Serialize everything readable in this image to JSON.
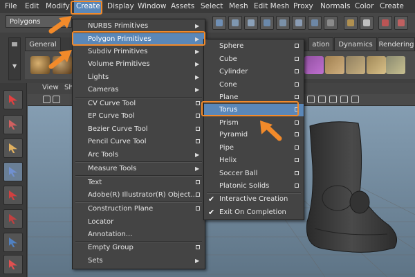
{
  "menubar": {
    "items": [
      "File",
      "Edit",
      "Modify",
      "Create",
      "Display",
      "Window",
      "Assets",
      "Select",
      "Mesh",
      "Edit Mesh",
      "Proxy",
      "Normals",
      "Color",
      "Create UVs"
    ]
  },
  "statusline": {
    "mode": "Polygons"
  },
  "shelf": {
    "tabs": [
      "General",
      "ation",
      "Dynamics",
      "Rendering"
    ]
  },
  "viewport": {
    "menu": [
      "View",
      "Sh"
    ]
  },
  "create_menu": {
    "items": [
      {
        "label": "NURBS Primitives",
        "arrow": true
      },
      {
        "label": "Polygon Primitives",
        "arrow": true
      },
      {
        "label": "Subdiv Primitives",
        "arrow": true
      },
      {
        "label": "Volume Primitives",
        "arrow": true
      },
      {
        "label": "Lights",
        "arrow": true
      },
      {
        "label": "Cameras",
        "arrow": true
      },
      {
        "label": "CV Curve Tool",
        "opt": true
      },
      {
        "label": "EP Curve Tool",
        "opt": true
      },
      {
        "label": "Bezier Curve Tool",
        "opt": true
      },
      {
        "label": "Pencil Curve Tool",
        "opt": true
      },
      {
        "label": "Arc Tools",
        "arrow": true
      },
      {
        "label": "Measure Tools",
        "arrow": true
      },
      {
        "label": "Text",
        "opt": true
      },
      {
        "label": "Adobe(R) Illustrator(R) Object...",
        "opt": true
      },
      {
        "label": "Construction Plane",
        "opt": true
      },
      {
        "label": "Locator"
      },
      {
        "label": "Annotation..."
      },
      {
        "label": "Empty Group",
        "opt": true
      },
      {
        "label": "Sets",
        "arrow": true
      }
    ]
  },
  "polygon_menu": {
    "items": [
      {
        "label": "Sphere",
        "opt": true
      },
      {
        "label": "Cube",
        "opt": true
      },
      {
        "label": "Cylinder",
        "opt": true
      },
      {
        "label": "Cone",
        "opt": true
      },
      {
        "label": "Plane",
        "opt": true
      },
      {
        "label": "Torus",
        "opt": true
      },
      {
        "label": "Prism",
        "opt": true
      },
      {
        "label": "Pyramid",
        "opt": true
      },
      {
        "label": "Pipe",
        "opt": true
      },
      {
        "label": "Helix",
        "opt": true
      },
      {
        "label": "Soccer Ball",
        "opt": true
      },
      {
        "label": "Platonic Solids",
        "opt": true
      },
      {
        "label": "Interactive Creation",
        "check": true
      },
      {
        "label": "Exit On Completion",
        "check": true
      }
    ]
  },
  "colors": {
    "highlight": "#5a87b8",
    "callout": "#f28a2a"
  }
}
